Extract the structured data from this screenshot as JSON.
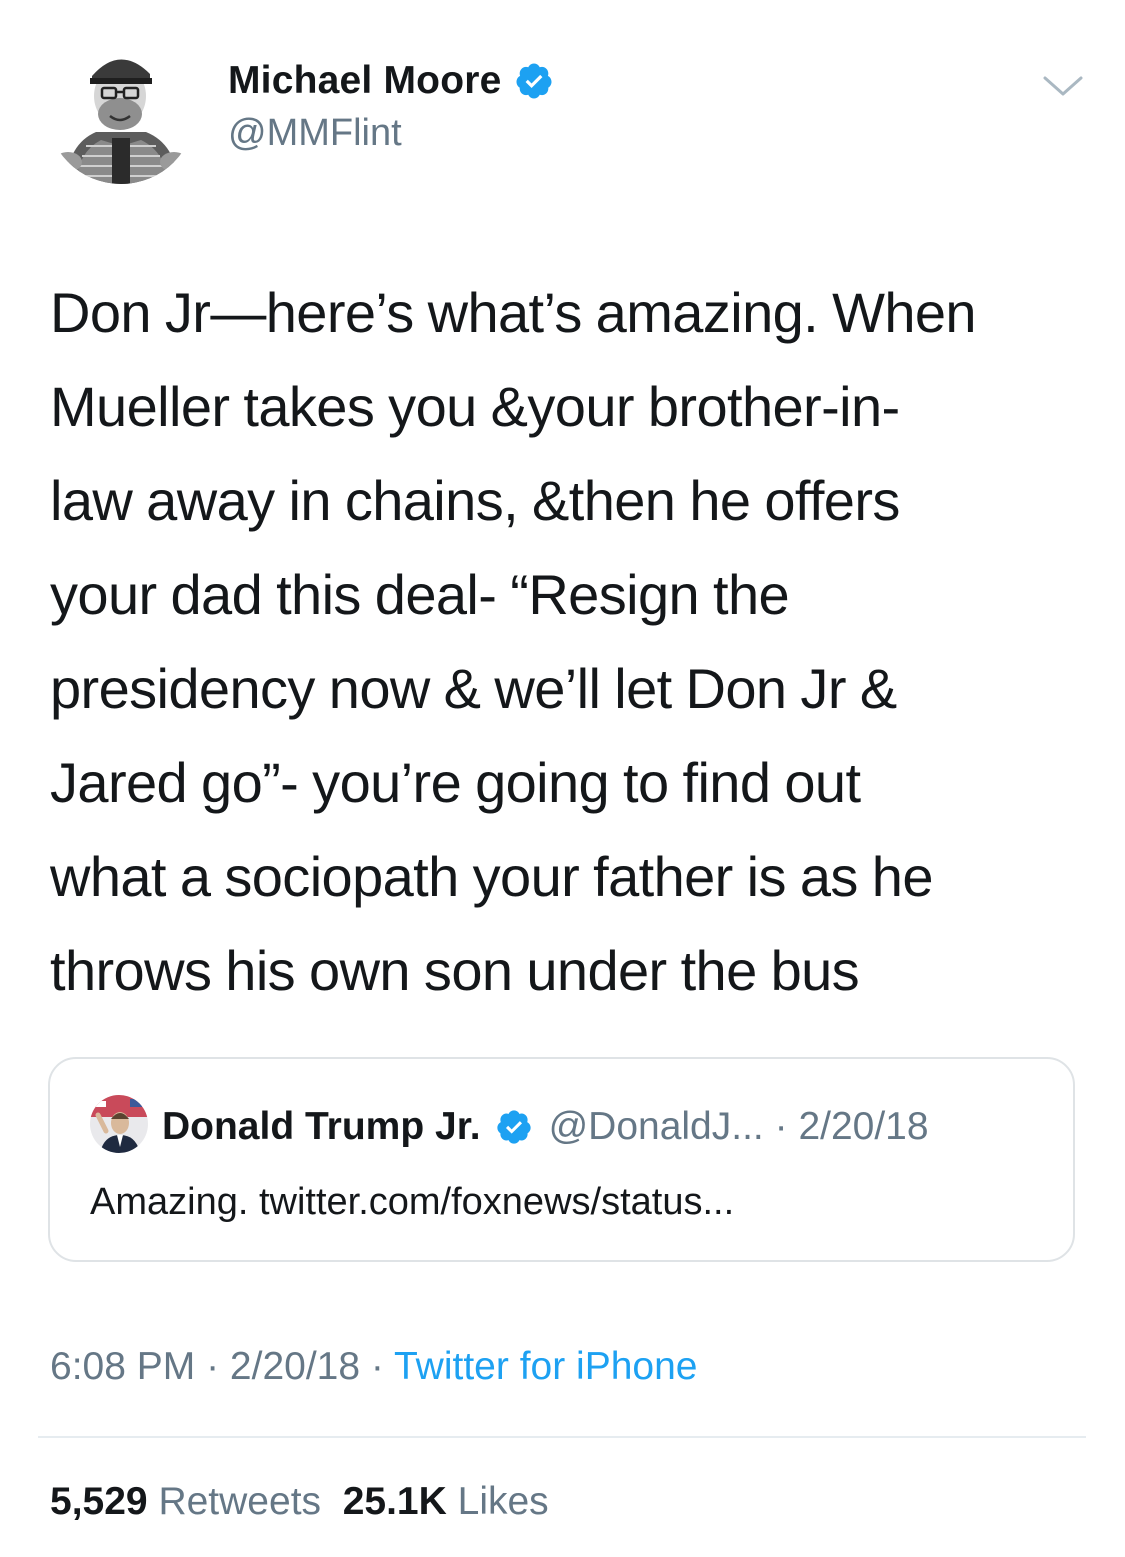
{
  "author": {
    "name": "Michael Moore",
    "handle": "@MMFlint",
    "verified": true,
    "avatar_icon": "caricature-avatar"
  },
  "menu_icon": "chevron-down-icon",
  "tweet": {
    "text": "Don Jr—here’s what’s amazing. When\nMueller takes you &your brother-in-\nlaw away in chains, &then he offers\nyour dad this deal- “Resign the\npresidency now & we’ll let Don Jr &\nJared go”- you’re going to find out\nwhat a sociopath your father is as he\nthrows his own son under the bus"
  },
  "quoted_tweet": {
    "name": "Donald Trump Jr.",
    "verified": true,
    "handle": "@DonaldJ...",
    "separator": "·",
    "date": "2/20/18",
    "text": "Amazing. twitter.com/foxnews/status..."
  },
  "meta": {
    "time": "6:08 PM",
    "separator": " · ",
    "date": "2/20/18",
    "source": "Twitter for iPhone"
  },
  "stats": {
    "retweets_count": "5,529",
    "retweets_label": "Retweets",
    "likes_count": "25.1K",
    "likes_label": "Likes"
  },
  "colors": {
    "accent": "#1da1f2",
    "secondary_text": "#657786",
    "primary_text": "#14171a",
    "border": "#dfe3e6"
  }
}
